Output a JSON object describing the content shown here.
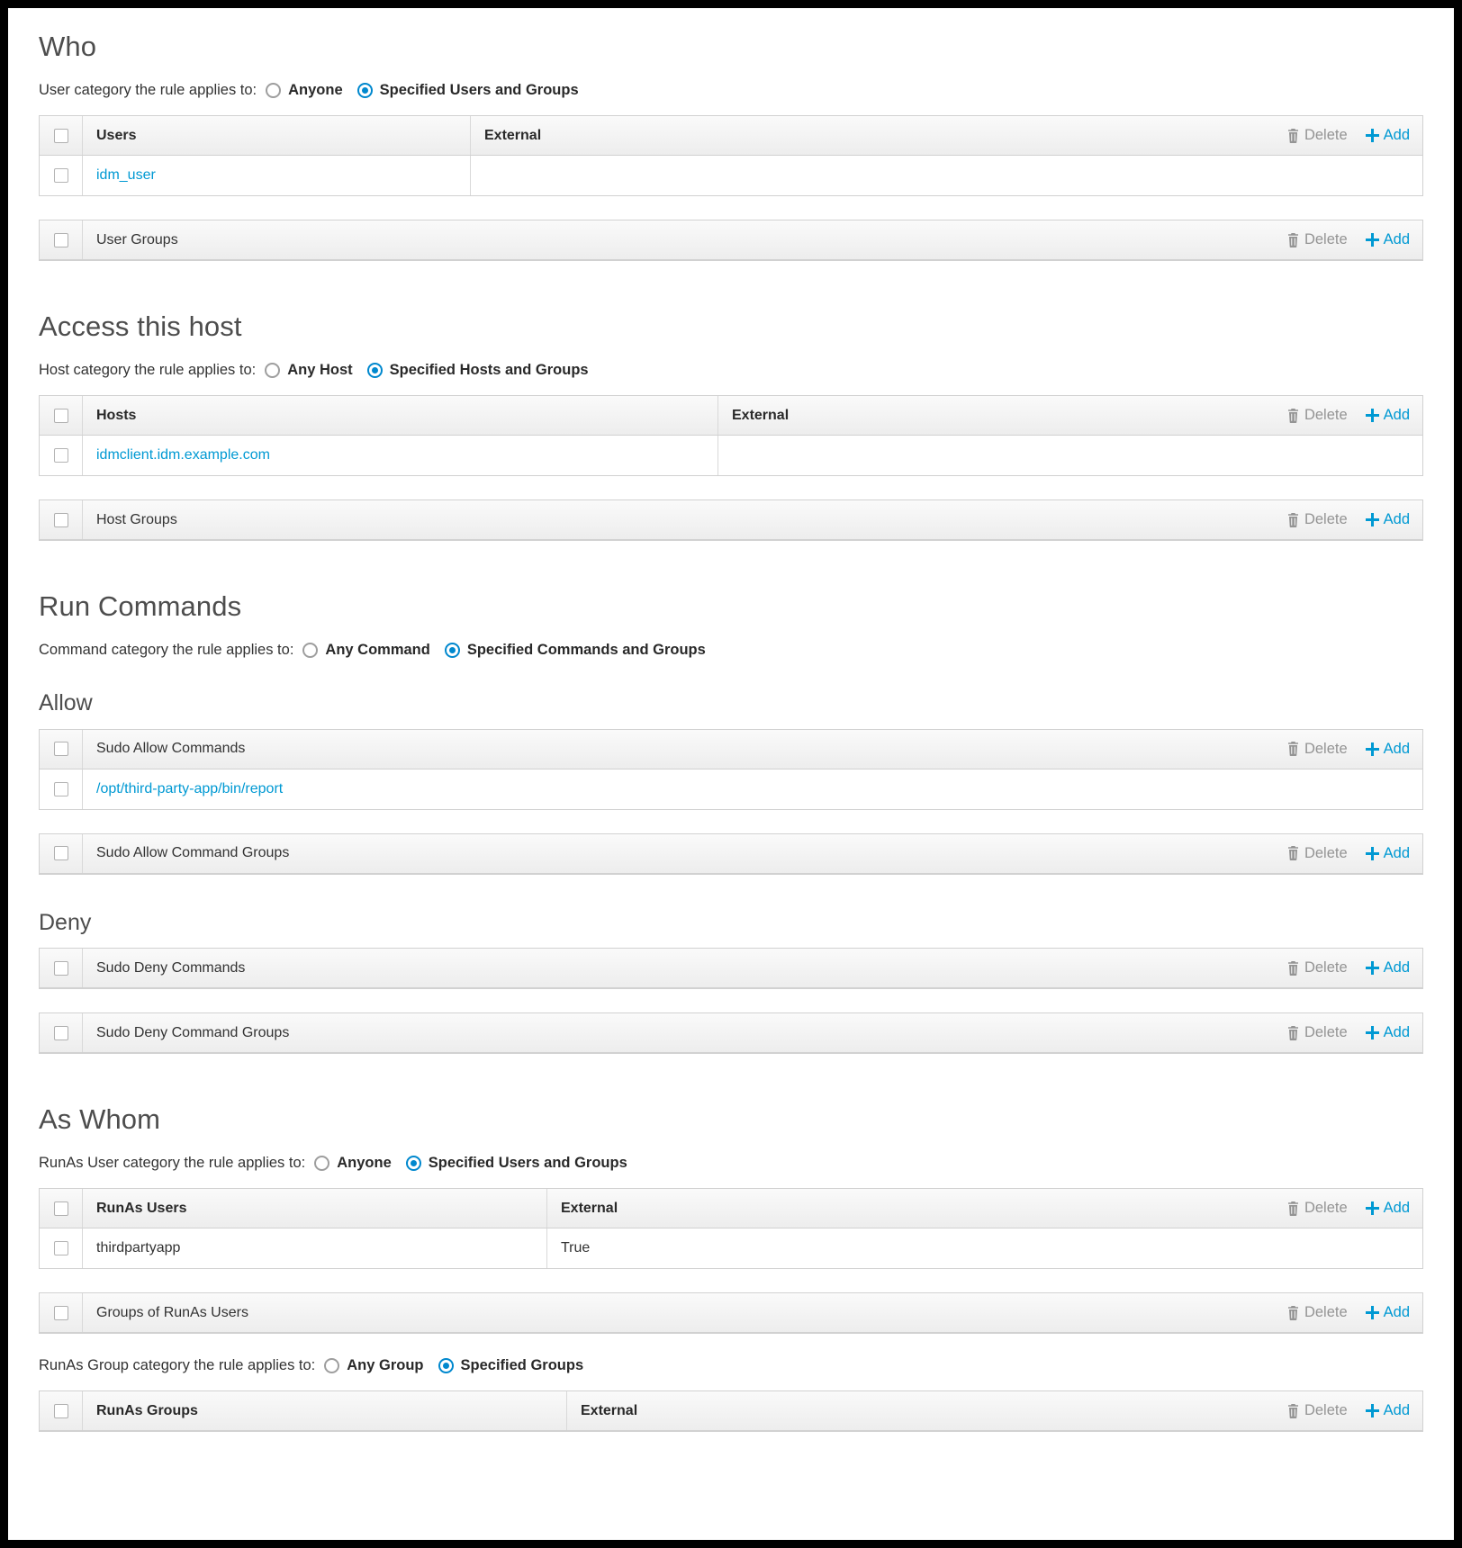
{
  "common": {
    "delete_label": "Delete",
    "add_label": "Add",
    "delete_icon": "trash-icon",
    "add_icon": "plus-icon",
    "external_header": "External",
    "accent_color": "#0099d3",
    "muted_color": "#949494"
  },
  "who": {
    "title": "Who",
    "category": {
      "prompt": "User category the rule applies to:",
      "options": [
        "Anyone",
        "Specified Users and Groups"
      ],
      "selected": "Specified Users and Groups"
    },
    "users_table": {
      "header": "Users",
      "external_header": "External",
      "rows": [
        {
          "name": "idm_user",
          "external": ""
        }
      ]
    },
    "user_groups_table": {
      "header": "User Groups",
      "rows": []
    }
  },
  "access_host": {
    "title": "Access this host",
    "category": {
      "prompt": "Host category the rule applies to:",
      "options": [
        "Any Host",
        "Specified Hosts and Groups"
      ],
      "selected": "Specified Hosts and Groups"
    },
    "hosts_table": {
      "header": "Hosts",
      "external_header": "External",
      "rows": [
        {
          "name": "idmclient.idm.example.com",
          "external": ""
        }
      ]
    },
    "host_groups_table": {
      "header": "Host Groups",
      "rows": []
    }
  },
  "run_commands": {
    "title": "Run Commands",
    "category": {
      "prompt": "Command category the rule applies to:",
      "options": [
        "Any Command",
        "Specified Commands and Groups"
      ],
      "selected": "Specified Commands and Groups"
    },
    "allow": {
      "title": "Allow",
      "commands_table": {
        "header": "Sudo Allow Commands",
        "rows": [
          {
            "name": "/opt/third-party-app/bin/report"
          }
        ]
      },
      "command_groups_table": {
        "header": "Sudo Allow Command Groups",
        "rows": []
      }
    },
    "deny": {
      "title": "Deny",
      "commands_table": {
        "header": "Sudo Deny Commands",
        "rows": []
      },
      "command_groups_table": {
        "header": "Sudo Deny Command Groups",
        "rows": []
      }
    }
  },
  "as_whom": {
    "title": "As Whom",
    "runas_user_category": {
      "prompt": "RunAs User category the rule applies to:",
      "options": [
        "Anyone",
        "Specified Users and Groups"
      ],
      "selected": "Specified Users and Groups"
    },
    "runas_users_table": {
      "header": "RunAs Users",
      "external_header": "External",
      "rows": [
        {
          "name": "thirdpartyapp",
          "external": "True"
        }
      ]
    },
    "groups_of_runas_users_table": {
      "header": "Groups of RunAs Users",
      "rows": []
    },
    "runas_group_category": {
      "prompt": "RunAs Group category the rule applies to:",
      "options": [
        "Any Group",
        "Specified Groups"
      ],
      "selected": "Specified Groups"
    },
    "runas_groups_table": {
      "header": "RunAs Groups",
      "external_header": "External",
      "rows": []
    }
  }
}
